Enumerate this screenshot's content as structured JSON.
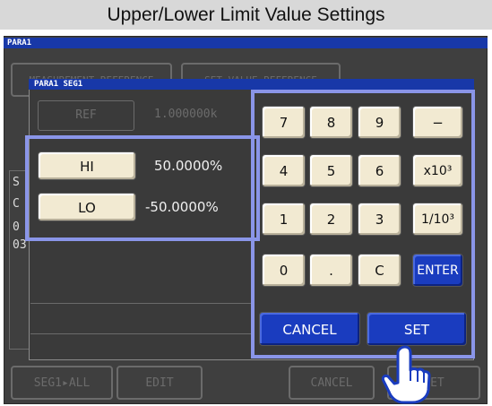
{
  "title": "Upper/Lower Limit Value Settings",
  "screen": {
    "header_label": "PARA1",
    "background_tabs": [
      "MEASUREMENT REFERENCE",
      "SET VALUE REFERENCE"
    ],
    "side_fragments": [
      "S",
      "C",
      "0",
      "03"
    ],
    "bottom_buttons": [
      "SEG1▸ALL",
      "EDIT",
      "CANCEL",
      "SET"
    ]
  },
  "dialog": {
    "title": "PARA1 SEG1",
    "ref_label": "REF",
    "ref_value": "1.000000k",
    "hi_label": "HI",
    "hi_value": "50.0000%",
    "lo_label": "LO",
    "lo_value": "-50.0000%",
    "keypad": [
      "7",
      "8",
      "9",
      "−",
      "4",
      "5",
      "6",
      "x10³",
      "1",
      "2",
      "3",
      "1/10³",
      "0",
      ".",
      "C",
      "ENTER"
    ],
    "cancel_label": "CANCEL",
    "set_label": "SET"
  },
  "colors": {
    "title_bg": "#d8d8d8",
    "screen_bg": "#3f3f3f",
    "header_blue": "#1838a8",
    "key_face": "#f2ead2",
    "action_blue": "#1a3cbf",
    "highlight": "#8a95e8"
  },
  "icons": {
    "pointer": "pointing-hand-icon"
  }
}
